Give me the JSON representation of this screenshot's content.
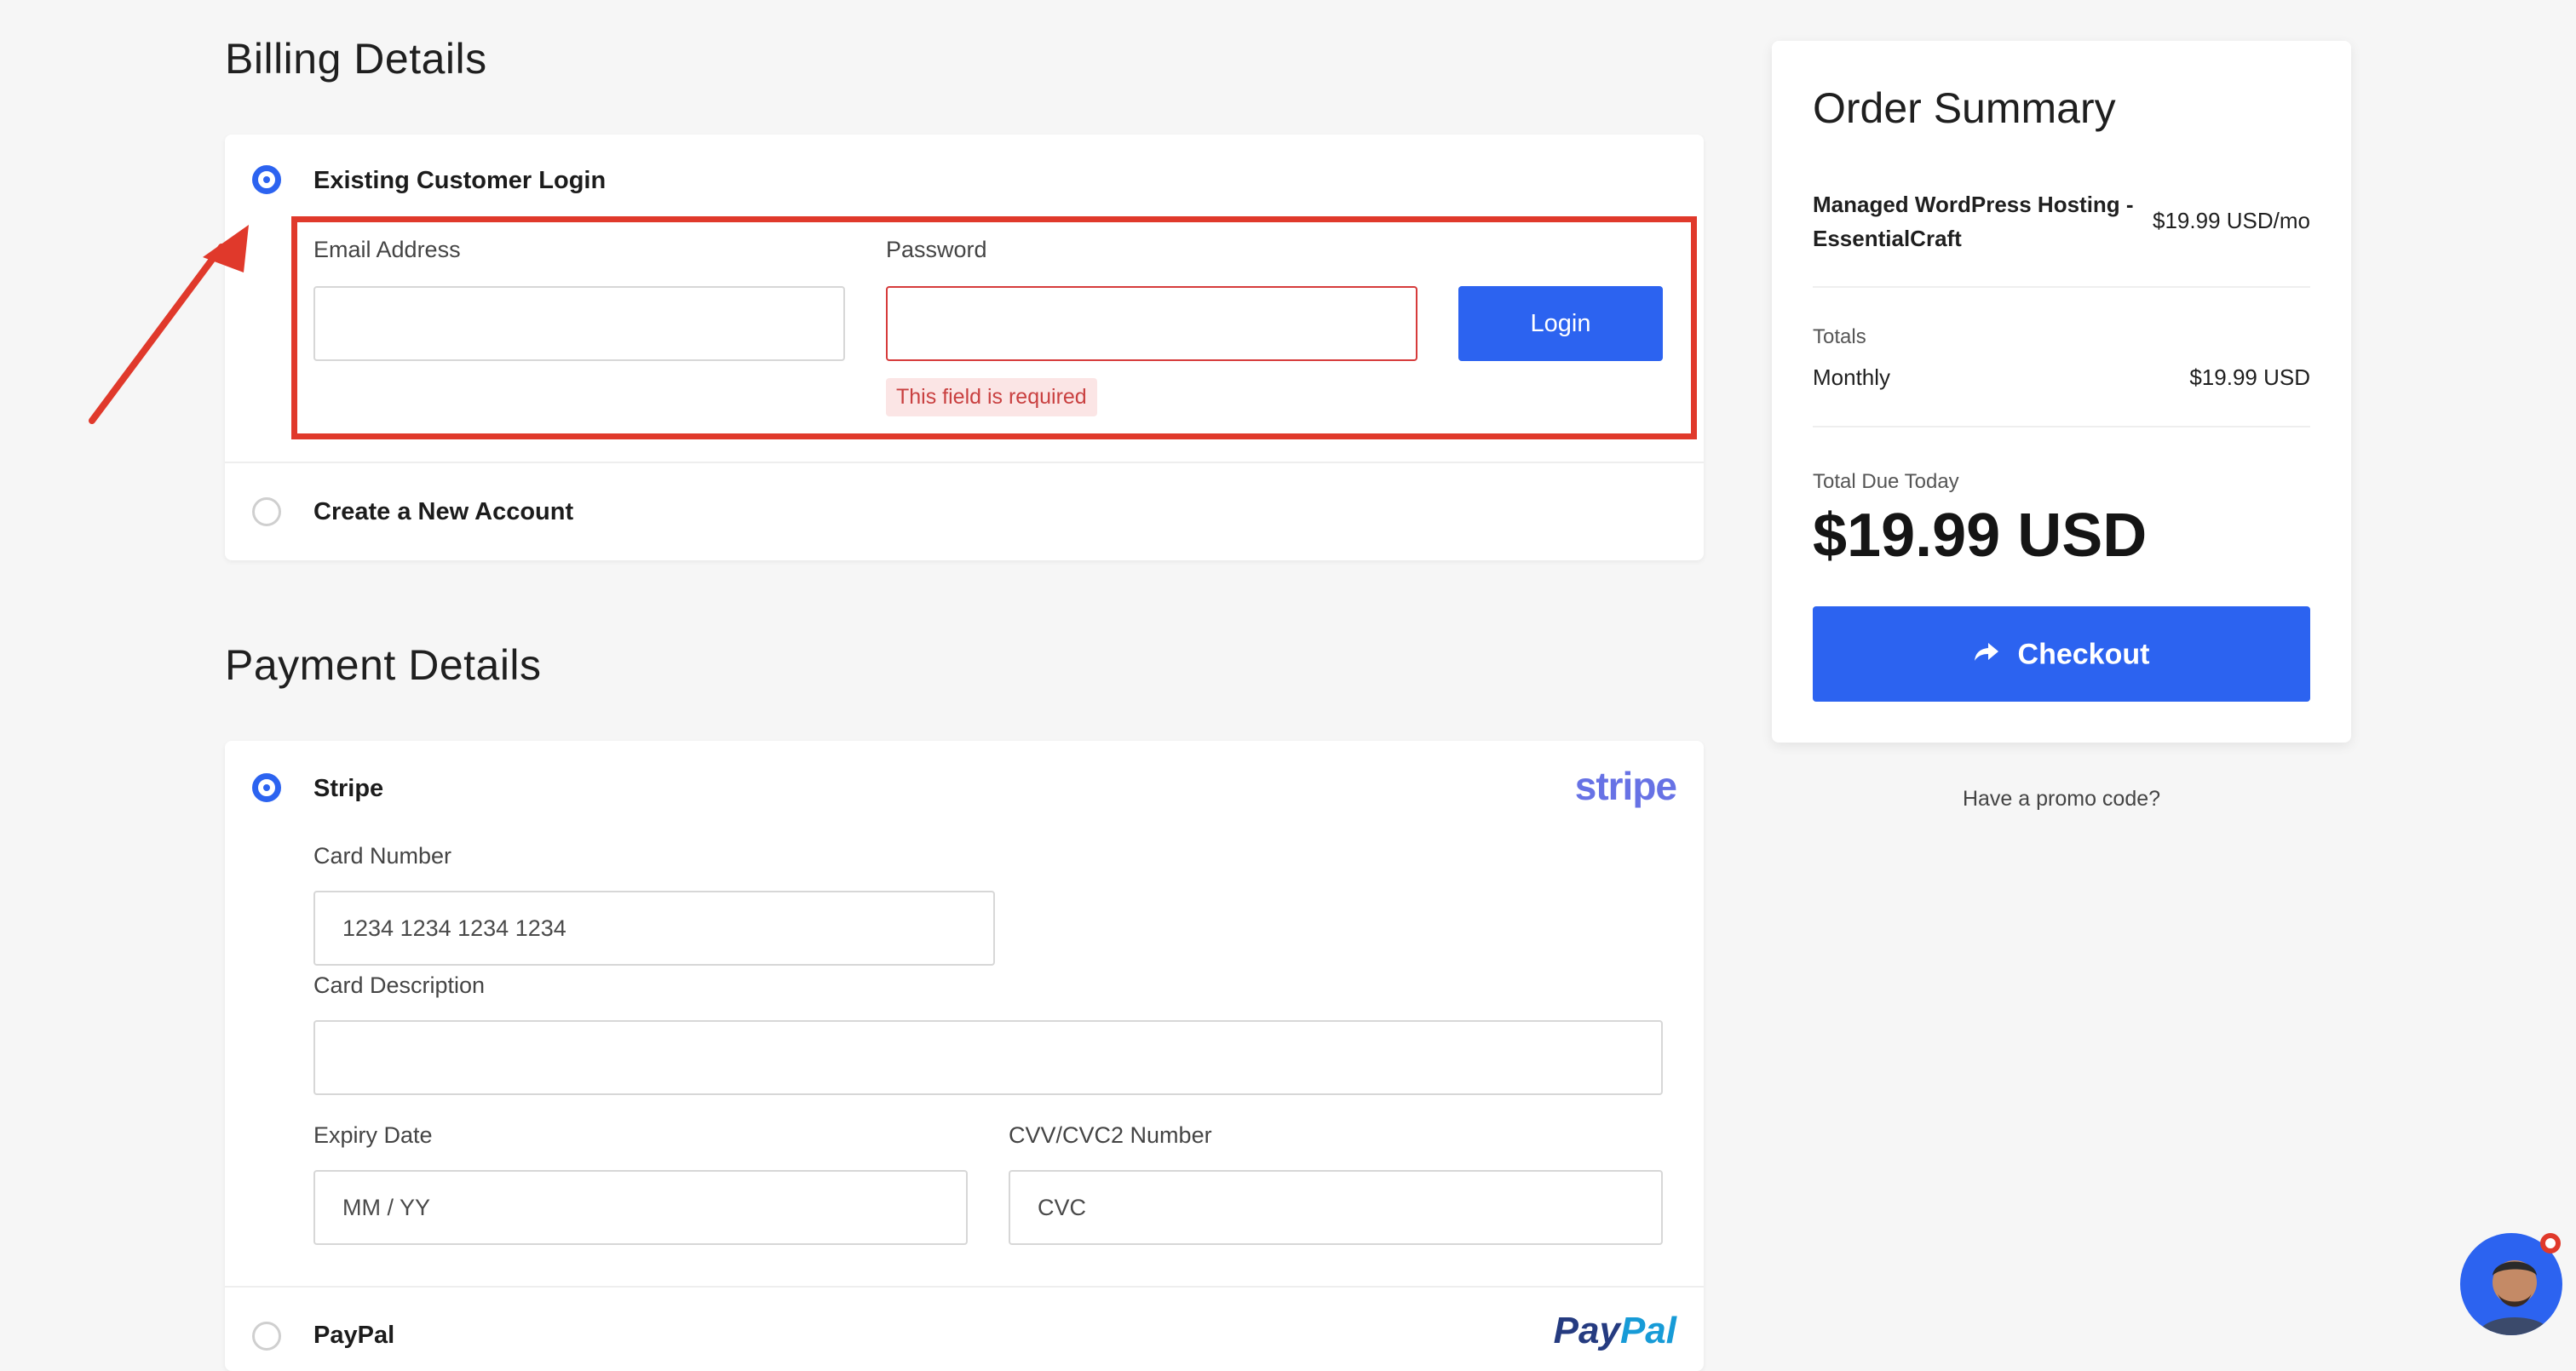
{
  "billing": {
    "title": "Billing Details",
    "existing_login_label": "Existing Customer Login",
    "email_label": "Email Address",
    "email_value": "",
    "password_label": "Password",
    "password_value": "",
    "login_button": "Login",
    "error_text": "This field is required",
    "new_account_label": "Create a New Account"
  },
  "payment": {
    "title": "Payment Details",
    "stripe_label": "Stripe",
    "stripe_logo": "stripe",
    "card_number_label": "Card Number",
    "card_number_placeholder": "1234 1234 1234 1234",
    "card_description_label": "Card Description",
    "card_description_value": "",
    "expiry_label": "Expiry Date",
    "expiry_placeholder": "MM / YY",
    "cvv_label": "CVV/CVC2 Number",
    "cvv_placeholder": "CVC",
    "paypal_label": "PayPal",
    "paypal_logo_a": "Pay",
    "paypal_logo_b": "Pal"
  },
  "summary": {
    "title": "Order Summary",
    "product_name_line1": "Managed WordPress Hosting -",
    "product_name_line2": "EssentialCraft",
    "product_price": "$19.99 USD/mo",
    "totals_label": "Totals",
    "monthly_label": "Monthly",
    "monthly_value": "$19.99 USD",
    "due_label": "Total Due Today",
    "due_value": "$19.99 USD",
    "checkout_button": "Checkout",
    "promo_link": "Have a promo code?"
  },
  "colors": {
    "accent": "#2c63f0",
    "error": "#d63b3b",
    "annotation": "#e0392b",
    "stripe": "#6772e5",
    "paypal_dark": "#253b80",
    "paypal_light": "#179bd7"
  },
  "icons": {
    "checkout": "arrow-share-icon",
    "chat": "chat-avatar-icon"
  }
}
